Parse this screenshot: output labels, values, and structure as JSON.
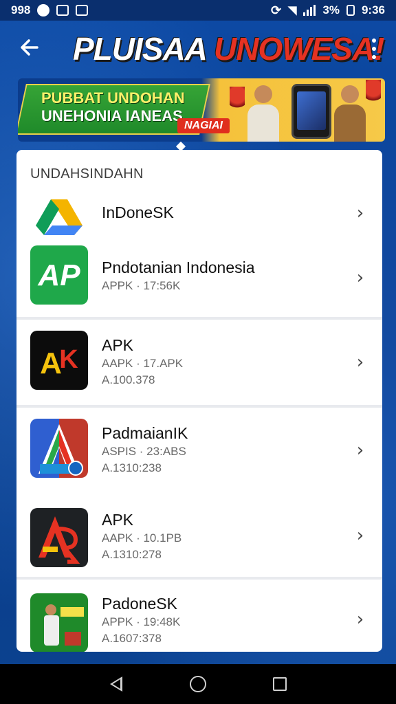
{
  "status_bar": {
    "left_text": "998",
    "battery": "3%",
    "time": "9:36"
  },
  "app_bar": {
    "title_part1": "PLUISAA",
    "title_part2": "UNOWESA!",
    "back_icon": "arrow-left-icon",
    "menu_icon": "more-vert-icon"
  },
  "banner": {
    "line1": "PUBBAT UNDOHAN",
    "line2": "UNEHONIA IANEAS",
    "badge": "NAGIAI"
  },
  "section": {
    "header": "UNDAHSINDAHN"
  },
  "apps": [
    {
      "name": "InDoneSK",
      "size": "",
      "version": "",
      "icon": "drive-triangle-icon"
    },
    {
      "name": "Pndotanian Indonesia",
      "size": "APPK · 17:56K",
      "version": "",
      "icon": "green-ap-icon"
    },
    {
      "name": "APK",
      "size": "AAPK · 17.APK",
      "version": "A.100.378",
      "icon": "black-ak-icon"
    },
    {
      "name": "PadmaianIK",
      "size": "ASPIS · 23:ABS",
      "version": "A.1310:238",
      "icon": "colorful-a-icon"
    },
    {
      "name": "APK",
      "size": "AAPK · 10.1PB",
      "version": "A.1310:278",
      "icon": "dark-ar-icon"
    },
    {
      "name": "PadoneSK",
      "size": "APPK · 19:48K",
      "version": "A.1607:378",
      "icon": "green-poster-icon"
    }
  ],
  "colors": {
    "background": "#0b3f8f",
    "title_red": "#e53222",
    "banner_green": "#1f8a2a",
    "banner_yellow": "#f5c23b"
  }
}
